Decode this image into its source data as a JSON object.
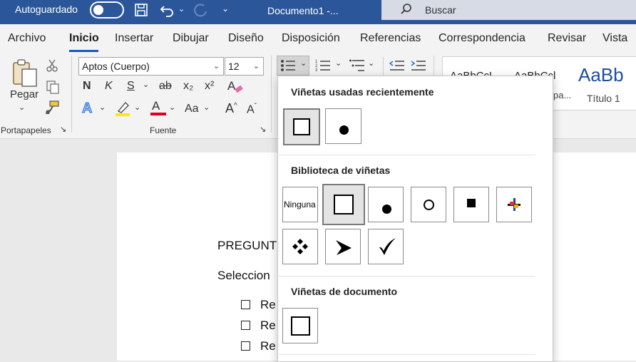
{
  "titlebar": {
    "autosave_label": "Autoguardado",
    "doc_title": "Documento1  -...",
    "search_label": "Buscar"
  },
  "menu": {
    "items": [
      "Archivo",
      "Inicio",
      "Insertar",
      "Dibujar",
      "Diseño",
      "Disposición",
      "Referencias",
      "Correspondencia",
      "Revisar",
      "Vista"
    ],
    "active": "Inicio"
  },
  "ribbon": {
    "paste_label": "Pegar",
    "clipboard_label": "Portapapeles",
    "font_label": "Fuente",
    "font_name": "Aptos (Cuerpo)",
    "font_size": "12",
    "bold": "N",
    "italic": "K",
    "underline": "S",
    "strike": "ab",
    "sub": "x₂",
    "sup": "x²",
    "font_color_letter": "A",
    "change_case": "Aa",
    "styles": {
      "s1": "AaBbCcL",
      "s2": "AaBbCcl",
      "s3": "AaBb",
      "s3_name": "Título 1",
      "s2_name_partial": "pa..."
    }
  },
  "dropdown": {
    "recent_heading": "Viñetas usadas recientemente",
    "library_heading": "Biblioteca de viñetas",
    "none_label": "Ninguna",
    "document_heading": "Viñetas de documento"
  },
  "document": {
    "line1": "PREGUNT",
    "line2": "Seleccion",
    "item1": "Re",
    "item2": "Re",
    "item3": "Re"
  }
}
